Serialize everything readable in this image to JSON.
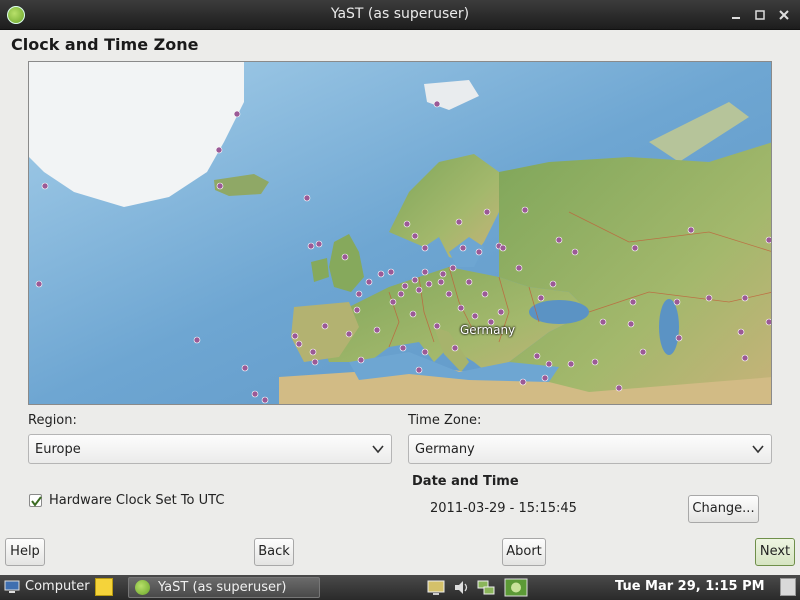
{
  "window": {
    "title": "YaST (as superuser)",
    "heading": "Clock and Time Zone",
    "controls": [
      "minimize-icon",
      "maximize-icon",
      "close-icon"
    ]
  },
  "map": {
    "selected_label": "Germany"
  },
  "region": {
    "label": "Region:",
    "value": "Europe"
  },
  "timezone": {
    "label": "Time Zone:",
    "value": "Germany"
  },
  "hardware_clock": {
    "label": "Hardware Clock Set To UTC",
    "checked": true
  },
  "date_time": {
    "title": "Date and Time",
    "value": "2011-03-29 - 15:15:45",
    "change_label": "Change..."
  },
  "buttons": {
    "help": "Help",
    "back": "Back",
    "abort": "Abort",
    "next": "Next"
  },
  "taskbar": {
    "computer_label": "Computer",
    "task_label": "YaST (as superuser)",
    "clock": "Tue Mar 29,  1:15 PM"
  },
  "colors": {
    "titlebar": "#2a2a2a",
    "background": "#ececea",
    "map_water": "#7cb4da",
    "map_land": "#8fae62",
    "city_dot": "#9b5a96"
  }
}
